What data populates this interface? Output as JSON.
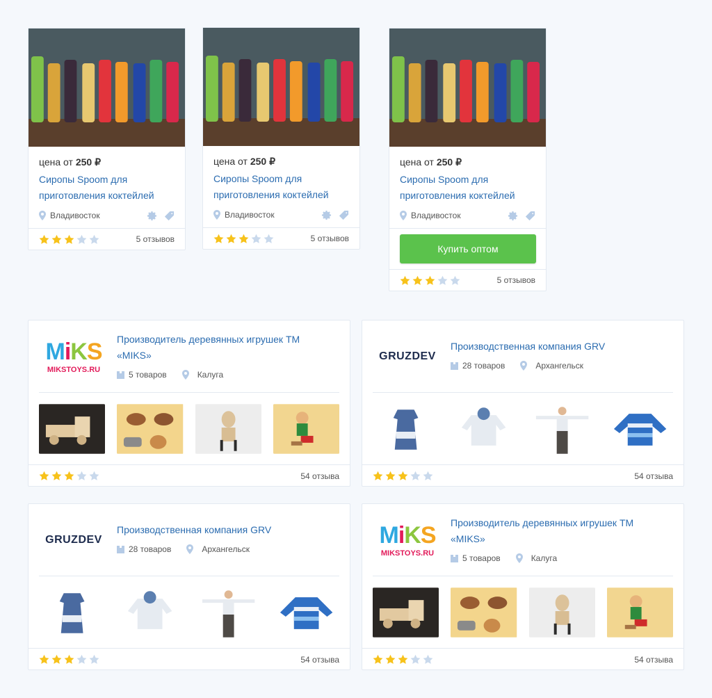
{
  "colors": {
    "link": "#2b6cb0",
    "buy_button": "#5bc24c",
    "star_filled": "#f7c21b",
    "star_empty": "#c9d9ec",
    "icon_muted": "#b5cbe6"
  },
  "products": [
    {
      "price_prefix": "цена от",
      "price_value": "250 ₽",
      "title_line1": "Сиропы Spoom для",
      "title_line2": "приготовления коктейлей",
      "city": "Владивосток",
      "rating": 3,
      "reviews": "5 отзывов",
      "has_buy_button": false
    },
    {
      "price_prefix": "цена от",
      "price_value": "250 ₽",
      "title_line1": "Сиропы Spoom для",
      "title_line2": "приготовления коктейлей",
      "city": "Владивосток",
      "rating": 3,
      "reviews": "5 отзывов",
      "has_buy_button": false
    },
    {
      "price_prefix": "цена от",
      "price_value": "250 ₽",
      "title_line1": "Сиропы Spoom для",
      "title_line2": "приготовления коктейлей",
      "city": "Владивосток",
      "rating": 3,
      "reviews": "5 отзывов",
      "has_buy_button": true,
      "buy_label": "Купить оптом"
    }
  ],
  "companies": [
    {
      "logo": "miks",
      "logo_text": "MiKS",
      "logo_sub": "MIKSTOYS.RU",
      "title_line1": "Производитель деревянных игрушек ТМ",
      "title_line2": "«MIKS»",
      "goods": "5 товаров",
      "city": "Калуга",
      "rating": 3,
      "reviews": "54 отзыва",
      "thumbs": [
        "wooden-truck",
        "wooden-birds",
        "wooden-deer-chair",
        "wooden-pinocchio"
      ]
    },
    {
      "logo": "gruzdev",
      "logo_text": "GRUZDEV",
      "title_line1": "Производственная компания GRV",
      "title_line2": "",
      "goods": "28 товаров",
      "city": "Архангельск",
      "rating": 3,
      "reviews": "54 отзыва",
      "thumbs": [
        "knit-dress",
        "knit-hoodie",
        "child-in-sweater",
        "striped-sweater"
      ]
    },
    {
      "logo": "gruzdev",
      "logo_text": "GRUZDEV",
      "title_line1": "Производственная компания GRV",
      "title_line2": "",
      "goods": "28 товаров",
      "city": "Архангельск",
      "rating": 3,
      "reviews": "54 отзыва",
      "thumbs": [
        "knit-dress",
        "knit-hoodie",
        "child-in-sweater",
        "striped-sweater"
      ]
    },
    {
      "logo": "miks",
      "logo_text": "MiKS",
      "logo_sub": "MIKSTOYS.RU",
      "title_line1": "Производитель деревянных игрушек ТМ",
      "title_line2": "«MIKS»",
      "goods": "5 товаров",
      "city": "Калуга",
      "rating": 3,
      "reviews": "54 отзыва",
      "thumbs": [
        "wooden-truck",
        "wooden-birds",
        "wooden-deer-chair",
        "wooden-pinocchio"
      ]
    }
  ]
}
